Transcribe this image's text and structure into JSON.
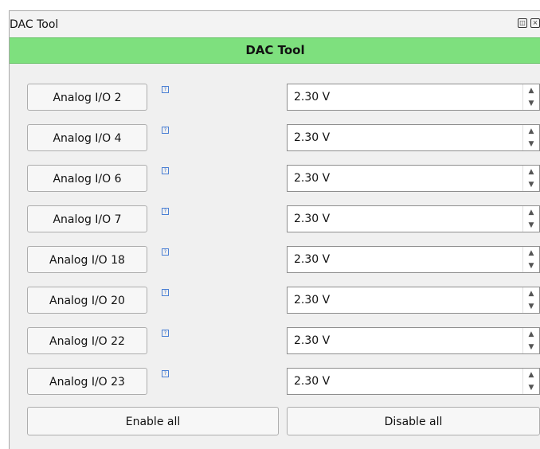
{
  "window": {
    "title": "DAC Tool",
    "icons": [
      "restore-icon",
      "close-icon"
    ]
  },
  "header": {
    "title": "DAC Tool"
  },
  "help_icon_glyph": "?",
  "channels": [
    {
      "label": "Analog I/O 2",
      "value": "2.30 V"
    },
    {
      "label": "Analog I/O 4",
      "value": "2.30 V"
    },
    {
      "label": "Analog I/O 6",
      "value": "2.30 V"
    },
    {
      "label": "Analog I/O 7",
      "value": "2.30 V"
    },
    {
      "label": "Analog I/O 18",
      "value": "2.30 V"
    },
    {
      "label": "Analog I/O 20",
      "value": "2.30 V"
    },
    {
      "label": "Analog I/O 22",
      "value": "2.30 V"
    },
    {
      "label": "Analog I/O 23",
      "value": "2.30 V"
    }
  ],
  "actions": {
    "enable_all": "Enable all",
    "disable_all": "Disable all"
  }
}
